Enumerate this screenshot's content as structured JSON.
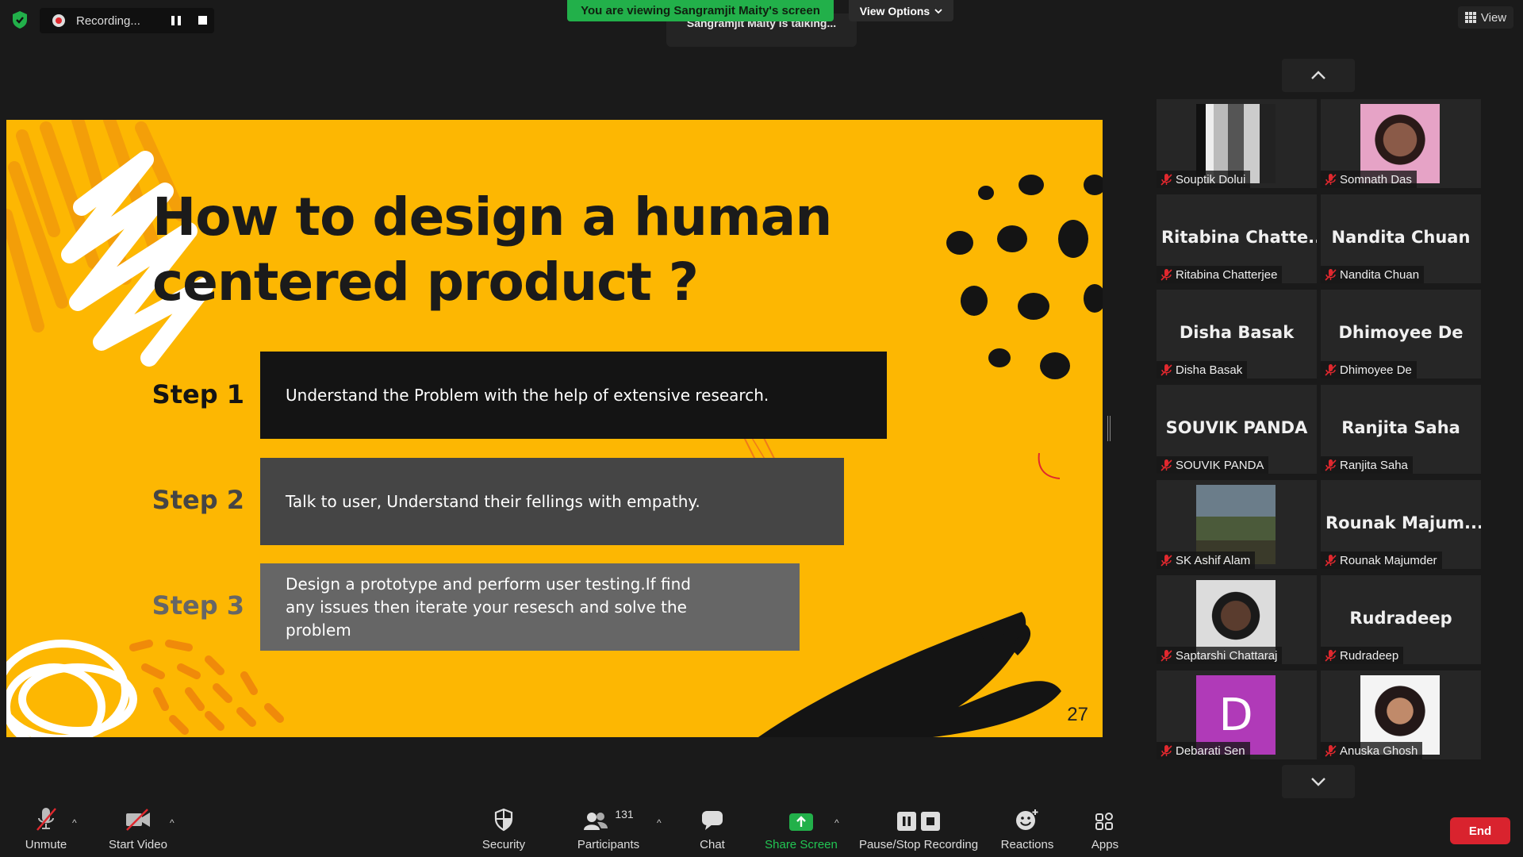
{
  "top": {
    "recording_label": "Recording...",
    "viewing_banner": "You are viewing Sangramjit Maity's screen",
    "view_options": "View Options",
    "talking": "Sangramjit Maity is talking...",
    "view_button": "View"
  },
  "slide": {
    "title_line1": "How to design a human",
    "title_line2": "centered product ?",
    "steps": [
      {
        "label": "Step 1",
        "text": "Understand the Problem with the help of extensive research."
      },
      {
        "label": "Step 2",
        "text": "Talk to user, Understand their fellings with empathy."
      },
      {
        "label": "Step 3",
        "text": "Design a prototype and perform user testing.If find any issues then iterate your resesch and solve the problem"
      }
    ],
    "page_number": "27",
    "colors": {
      "background": "#fdb702",
      "step1": "#141414",
      "step2": "#454545",
      "step3": "#666666"
    }
  },
  "gallery": {
    "participants": [
      {
        "name": "Souptik Dolui",
        "big": ""
      },
      {
        "name": "Somnath Das",
        "big": ""
      },
      {
        "name": "Ritabina Chatterjee",
        "big": "Ritabina  Chatte..."
      },
      {
        "name": "Nandita Chuan",
        "big": "Nandita Chuan"
      },
      {
        "name": "Disha Basak",
        "big": "Disha Basak"
      },
      {
        "name": "Dhimoyee De",
        "big": "Dhimoyee De"
      },
      {
        "name": "SOUVIK PANDA",
        "big": "SOUVIK PANDA"
      },
      {
        "name": "Ranjita Saha",
        "big": "Ranjita Saha"
      },
      {
        "name": "SK Ashif Alam",
        "big": ""
      },
      {
        "name": "Rounak Majumder",
        "big": "Rounak  Majum..."
      },
      {
        "name": "Saptarshi Chattaraj",
        "big": ""
      },
      {
        "name": "Rudradeep",
        "big": "Rudradeep"
      },
      {
        "name": "Debarati Sen",
        "big": ""
      },
      {
        "name": "Anuska Ghosh",
        "big": ""
      }
    ],
    "avatar_letter": "D"
  },
  "toolbar": {
    "unmute": "Unmute",
    "start_video": "Start Video",
    "security": "Security",
    "participants": "Participants",
    "participant_count": "131",
    "chat": "Chat",
    "share_screen": "Share Screen",
    "pause_stop": "Pause/Stop Recording",
    "reactions": "Reactions",
    "apps": "Apps",
    "end": "End"
  }
}
